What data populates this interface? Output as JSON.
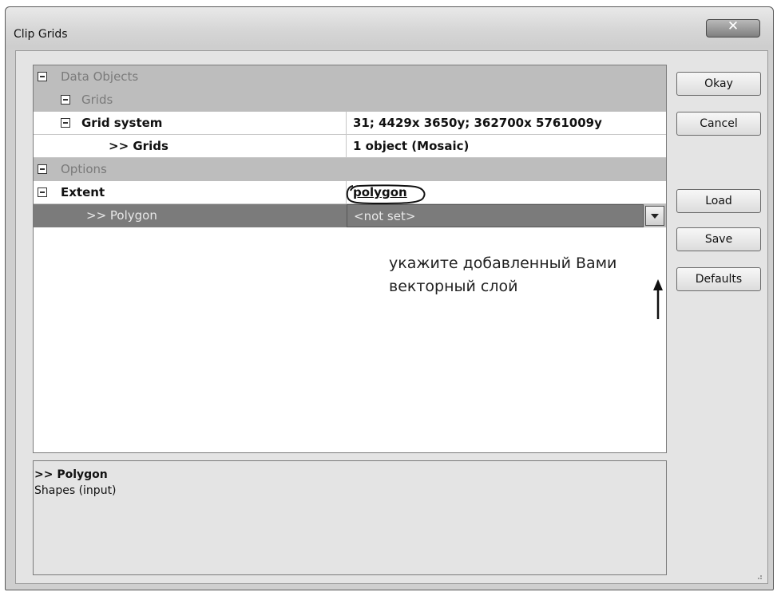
{
  "window": {
    "title": "Clip Grids"
  },
  "buttons": {
    "okay": "Okay",
    "cancel": "Cancel",
    "load": "Load",
    "save": "Save",
    "defaults": "Defaults"
  },
  "grid": {
    "rows": [
      {
        "label": "Data Objects",
        "value": ""
      },
      {
        "label": "Grids",
        "value": ""
      },
      {
        "label": "Grid system",
        "value": "31; 4429x 3650y; 362700x 5761009y"
      },
      {
        "label": ">> Grids",
        "value": "1 object (Mosaic)"
      },
      {
        "label": "Options",
        "value": ""
      },
      {
        "label": "Extent",
        "value": "polygon"
      },
      {
        "label": ">> Polygon",
        "value": "<not set>"
      }
    ]
  },
  "annotation": {
    "line1": "укажите добавленный Вами",
    "line2": "векторный слой"
  },
  "description": {
    "title": ">> Polygon",
    "text": "Shapes (input)"
  }
}
